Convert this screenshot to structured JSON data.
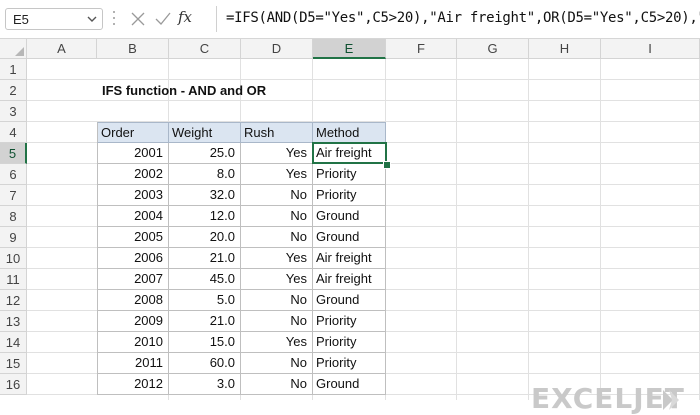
{
  "formula_bar": {
    "name_box": "E5",
    "fx_label": "fx",
    "formula": "=IFS(AND(D5=\"Yes\",C5>20),\"Air freight\",OR(D5=\"Yes\",C5>20),\""
  },
  "columns": [
    "A",
    "B",
    "C",
    "D",
    "E",
    "F",
    "G",
    "H",
    "I"
  ],
  "selected_column": "E",
  "rows": [
    "1",
    "2",
    "3",
    "4",
    "5",
    "6",
    "7",
    "8",
    "9",
    "10",
    "11",
    "12",
    "13",
    "14",
    "15",
    "16"
  ],
  "selected_row": "5",
  "sheet": {
    "title": "IFS function - AND and OR",
    "table": {
      "headers": [
        "Order",
        "Weight",
        "Rush",
        "Method"
      ],
      "rows": [
        [
          "2001",
          "25.0",
          "Yes",
          "Air freight"
        ],
        [
          "2002",
          "8.0",
          "Yes",
          "Priority"
        ],
        [
          "2003",
          "32.0",
          "No",
          "Priority"
        ],
        [
          "2004",
          "12.0",
          "No",
          "Ground"
        ],
        [
          "2005",
          "20.0",
          "No",
          "Ground"
        ],
        [
          "2006",
          "21.0",
          "Yes",
          "Air freight"
        ],
        [
          "2007",
          "45.0",
          "Yes",
          "Air freight"
        ],
        [
          "2008",
          "5.0",
          "No",
          "Ground"
        ],
        [
          "2009",
          "21.0",
          "No",
          "Priority"
        ],
        [
          "2010",
          "15.0",
          "Yes",
          "Priority"
        ],
        [
          "2011",
          "60.0",
          "No",
          "Priority"
        ],
        [
          "2012",
          "3.0",
          "No",
          "Ground"
        ]
      ]
    },
    "active_cell": "E5"
  },
  "branding": {
    "logo_text": "EXCELJET",
    "logo_color": "#c9c9c9"
  },
  "colors": {
    "accent": "#217346",
    "header_fill": "#dbe5f1"
  }
}
